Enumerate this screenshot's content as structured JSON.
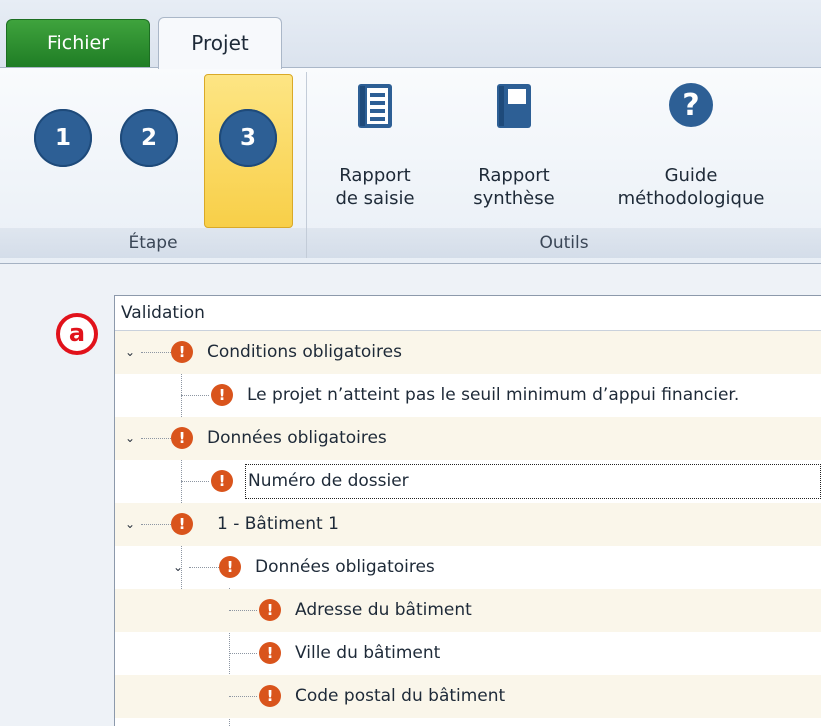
{
  "tabs": {
    "file": "Fichier",
    "project": "Projet"
  },
  "ribbon": {
    "steps": [
      {
        "label": "1",
        "active": false
      },
      {
        "label": "2",
        "active": false
      },
      {
        "label": "3",
        "active": true
      }
    ],
    "step_group": "Étape",
    "tools_group": "Outils",
    "tools": [
      {
        "line1": "Rapport",
        "line2": "de saisie",
        "icon": "report-entry-icon"
      },
      {
        "line1": "Rapport",
        "line2": "synthèse",
        "icon": "report-summary-icon"
      },
      {
        "line1": "Guide",
        "line2": "méthodologique",
        "icon": "help-icon"
      }
    ]
  },
  "annotation": "a",
  "tree": {
    "header": "Validation",
    "items": [
      {
        "level": 0,
        "text": "Conditions obligatoires",
        "expanded": true
      },
      {
        "level": 1,
        "text": "Le projet n’atteint pas le seuil minimum d’appui financier."
      },
      {
        "level": 0,
        "text": "Données obligatoires",
        "expanded": true
      },
      {
        "level": 1,
        "text": "Numéro de dossier",
        "focused": true
      },
      {
        "level": 0,
        "text": "1 - Bâtiment 1",
        "expanded": true
      },
      {
        "level": 1,
        "text": "Données obligatoires",
        "expanded": true
      },
      {
        "level": 2,
        "text": "Adresse du bâtiment"
      },
      {
        "level": 2,
        "text": "Ville du bâtiment"
      },
      {
        "level": 2,
        "text": "Code postal du bâtiment"
      }
    ]
  },
  "colors": {
    "file_tab": "#2f8f33",
    "step": "#2d5f95",
    "step_active": "#f8cf48",
    "error": "#d9541c",
    "annotation": "#e1121b"
  }
}
